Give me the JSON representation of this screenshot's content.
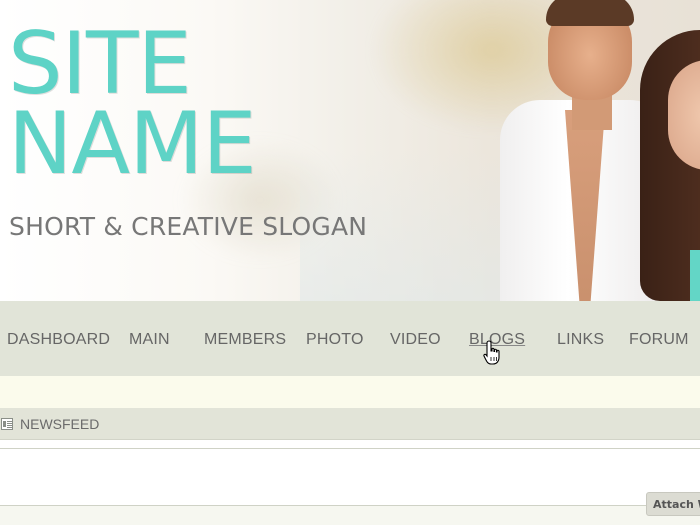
{
  "header": {
    "site_name_line1": "SITE",
    "site_name_line2": "NAME",
    "slogan": "SHORT & CREATIVE SLOGAN",
    "accent_color": "#5ed3c6"
  },
  "nav": {
    "items": [
      {
        "label": "DASHBOARD"
      },
      {
        "label": "MAIN"
      },
      {
        "label": "MEMBERS"
      },
      {
        "label": "PHOTO"
      },
      {
        "label": "VIDEO"
      },
      {
        "label": "BLOGS",
        "hovered": true
      },
      {
        "label": "LINKS"
      },
      {
        "label": "FORUM"
      }
    ]
  },
  "newsfeed": {
    "icon": "newsfeed-icon",
    "title": "NEWSFEED"
  },
  "attach_tab": {
    "label": "Attach W"
  },
  "cursor": {
    "icon": "hand-pointer-icon"
  }
}
